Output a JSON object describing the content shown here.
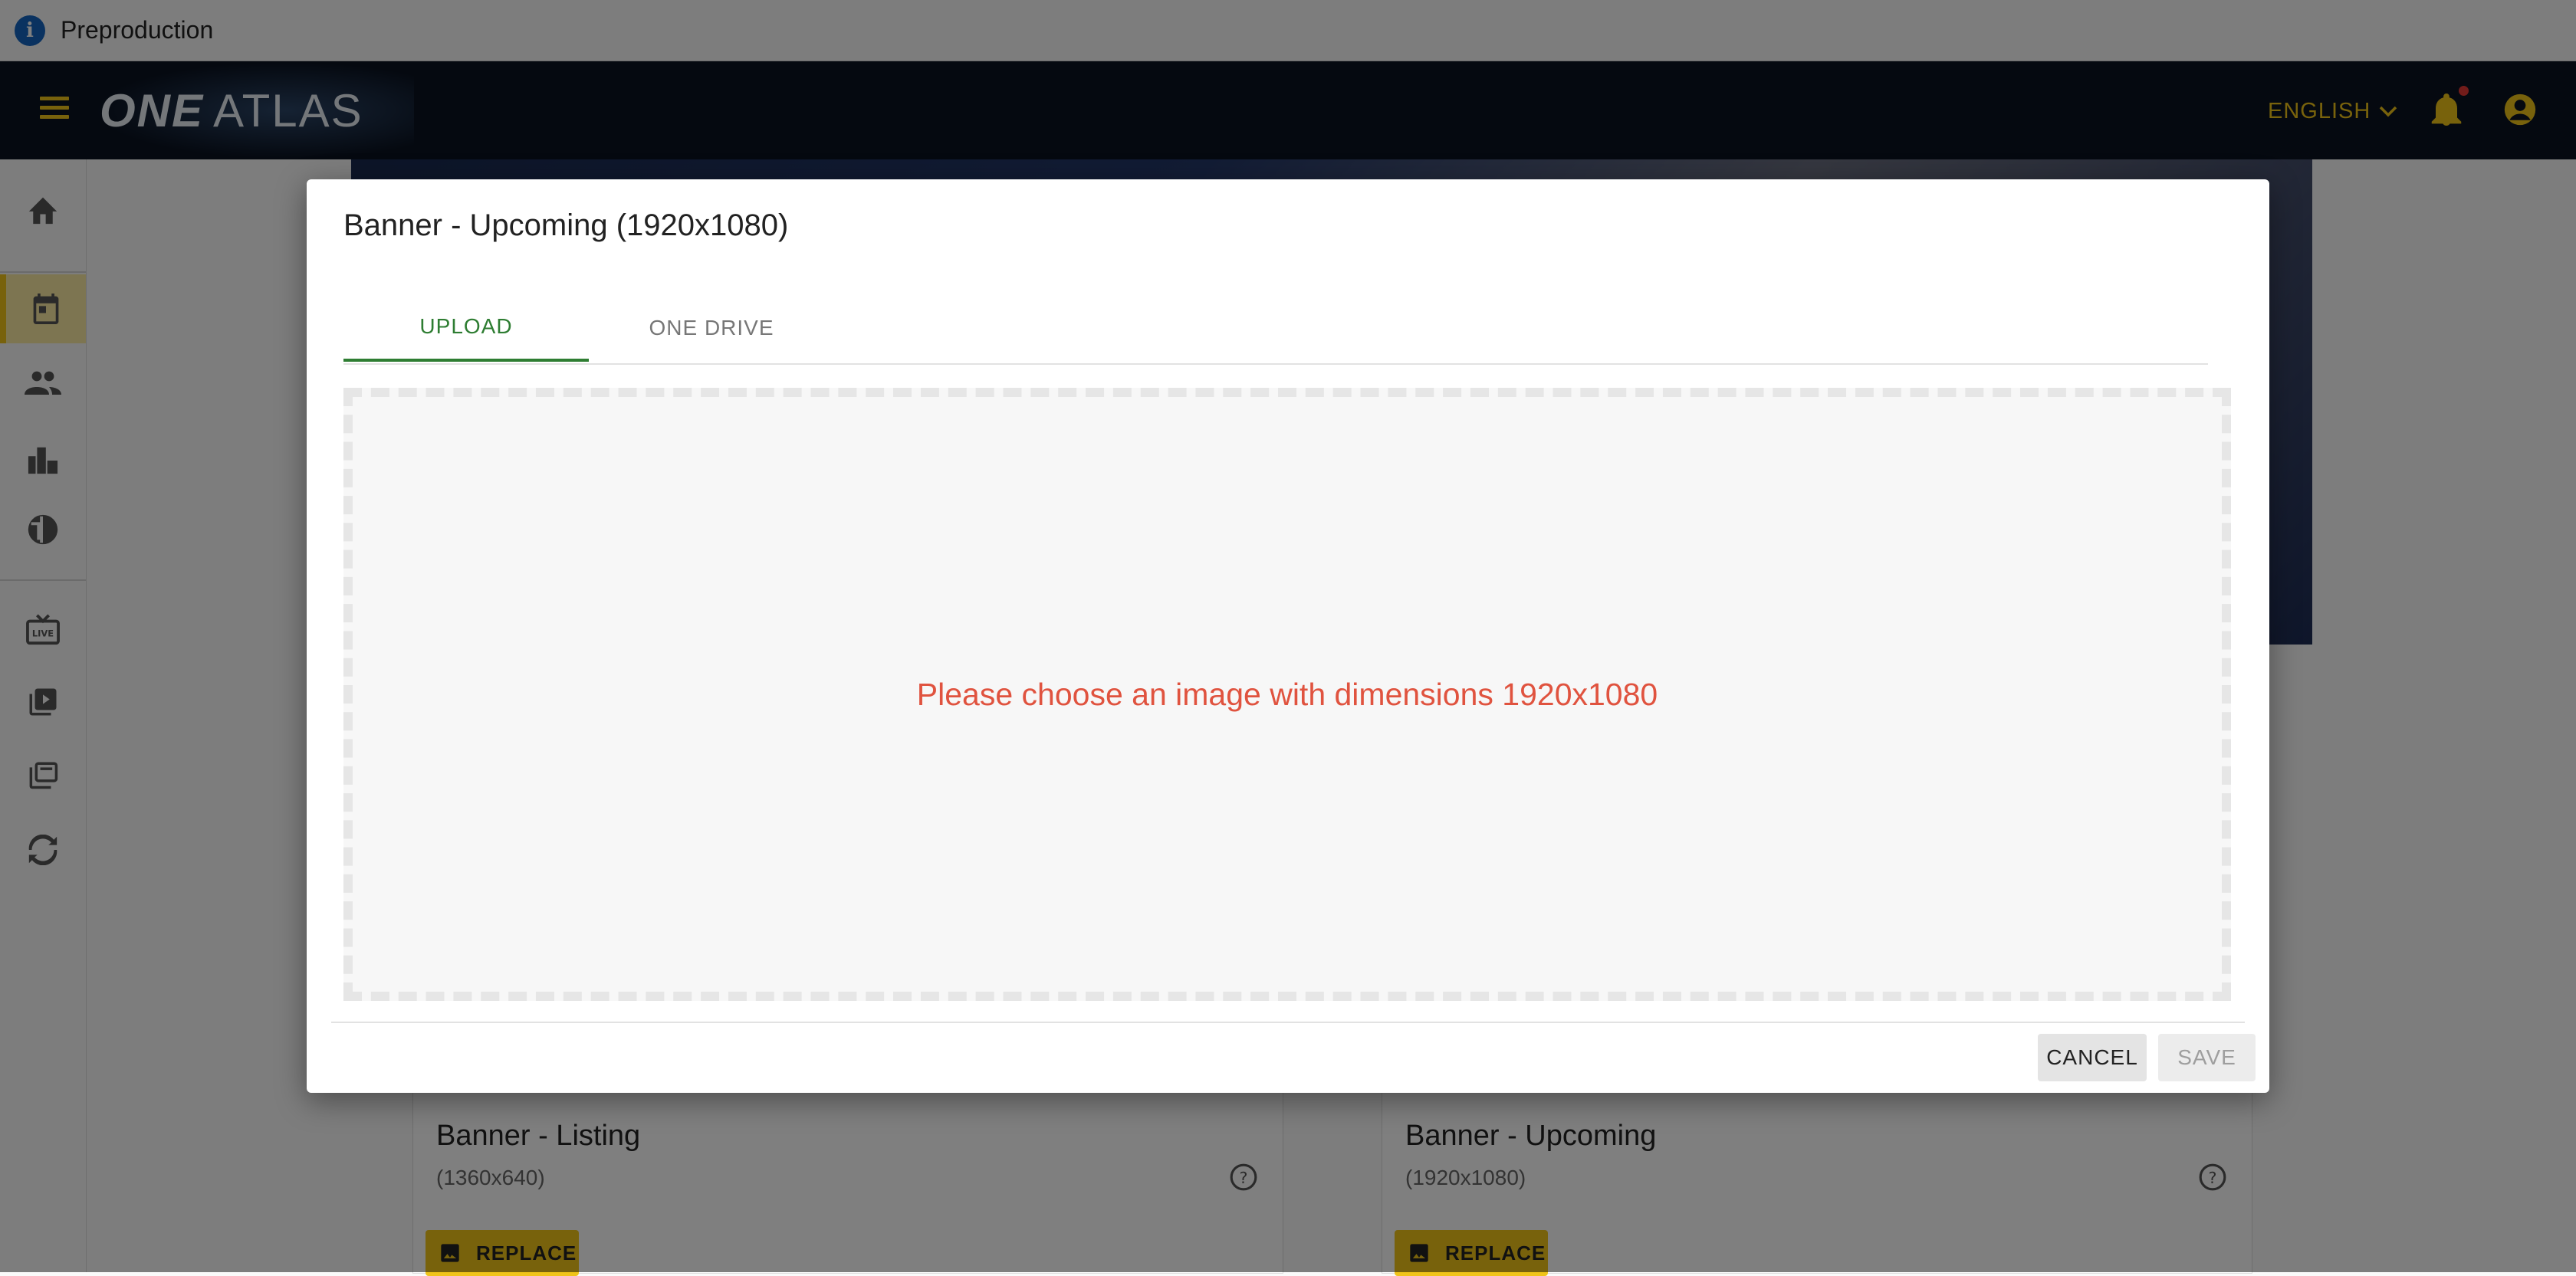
{
  "environment": {
    "label": "Preproduction",
    "icon": "info-icon"
  },
  "appbar": {
    "logo_one": "ONE",
    "logo_atlas": "ATLAS",
    "language": "ENGLISH",
    "accent_color": "#f0c419",
    "background_color": "#0a1220"
  },
  "sidebar": {
    "items": [
      {
        "icon": "home-icon"
      },
      {
        "icon": "calendar-icon",
        "active": true
      },
      {
        "icon": "people-icon"
      },
      {
        "icon": "business-icon"
      },
      {
        "icon": "sports-icon"
      },
      {
        "icon": "live-tv-icon"
      },
      {
        "icon": "video-library-icon"
      },
      {
        "icon": "collections-icon"
      },
      {
        "icon": "sync-icon"
      }
    ]
  },
  "background_cards": [
    {
      "title": "Banner - Listing",
      "subtitle": "(1360x640)",
      "button": "REPLACE"
    },
    {
      "title": "Banner - Upcoming",
      "subtitle": "(1920x1080)",
      "button": "REPLACE"
    }
  ],
  "dialog": {
    "title": "Banner - Upcoming (1920x1080)",
    "tabs": [
      {
        "label": "UPLOAD",
        "active": true
      },
      {
        "label": "ONE DRIVE",
        "active": false
      }
    ],
    "drop_message": "Please choose an image with dimensions 1920x1080",
    "message_color": "#e0533f",
    "active_tab_color": "#2e7d32",
    "cancel_label": "CANCEL",
    "save_label": "SAVE",
    "save_disabled": true
  }
}
